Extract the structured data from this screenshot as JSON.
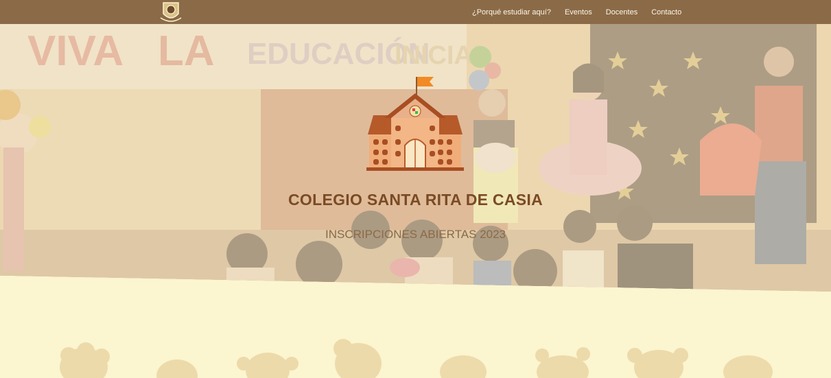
{
  "navbar": {
    "links": [
      {
        "label": "¿Porqué estudiar aquí?"
      },
      {
        "label": "Eventos"
      },
      {
        "label": "Docentes"
      },
      {
        "label": "Contacto"
      }
    ]
  },
  "hero": {
    "title": "COLEGIO SANTA RITA DE CASIA",
    "subtitle": "INSCRIPCIONES ABIERTAS 2023",
    "banner_text": "VIVA LA EDUCACIÓN INICIAL"
  },
  "colors": {
    "navbar": "#8b6a47",
    "title": "#7a4b24",
    "page_bg": "#fbf5d0"
  }
}
